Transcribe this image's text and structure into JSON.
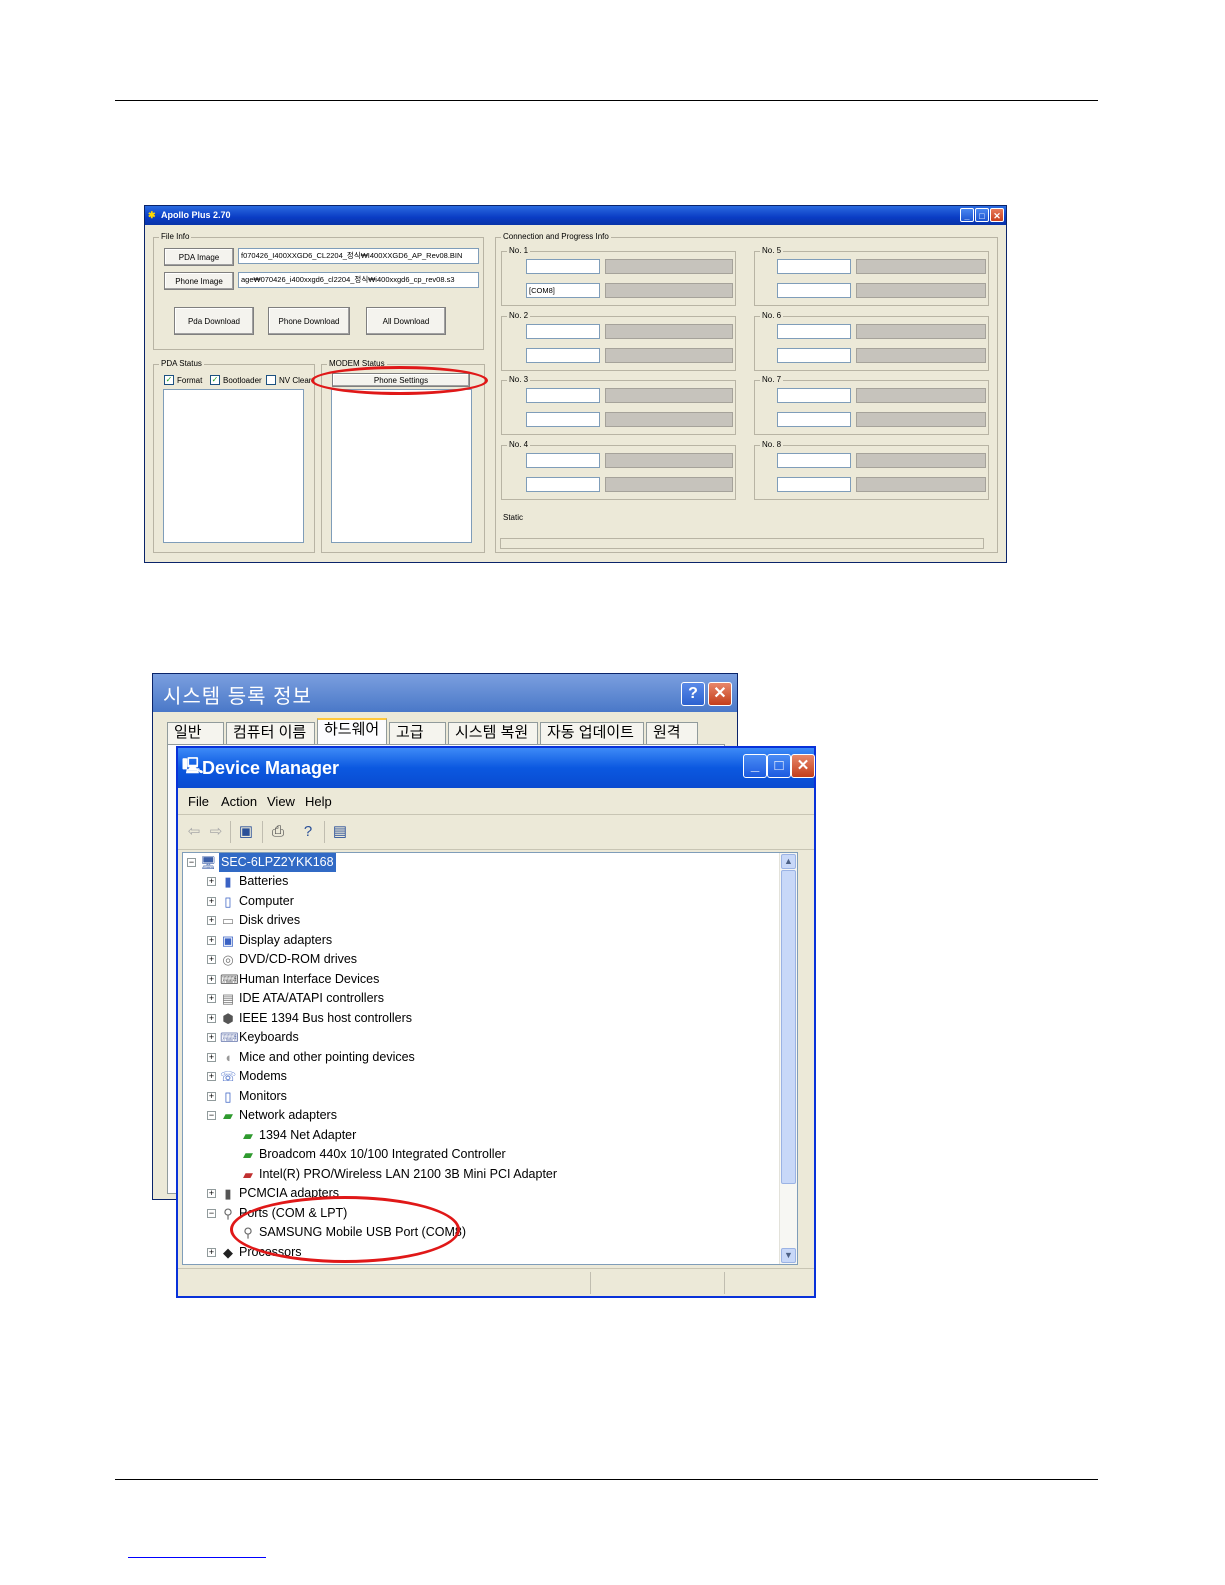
{
  "apollo": {
    "title": "Apollo Plus 2.70",
    "file_info": {
      "group_label": "File Info",
      "pda_image_button": "PDA Image",
      "pda_image_path": "f070426_I400XXGD6_CL2204_정식₩I400XXGD6_AP_Rev08.BIN",
      "phone_image_button": "Phone Image",
      "phone_image_path": "age₩070426_i400xxgd6_cl2204_정식₩i400xxgd6_cp_rev08.s3",
      "pda_download_button": "Pda Download",
      "phone_download_button": "Phone Download",
      "all_download_button": "All Download"
    },
    "pda_status": {
      "group_label": "PDA Status",
      "format_label": "Format",
      "bootloader_label": "Bootloader",
      "nv_clear_label": "NV Clear",
      "checkmark": "✓"
    },
    "modem_status": {
      "group_label": "MODEM Status",
      "phone_settings_button": "Phone Settings"
    },
    "connection": {
      "group_label": "Connection and Progress Info",
      "slots": [
        {
          "label": "No. 1",
          "port1": "",
          "port2": "[COM8]"
        },
        {
          "label": "No. 2",
          "port1": "",
          "port2": ""
        },
        {
          "label": "No. 3",
          "port1": "",
          "port2": ""
        },
        {
          "label": "No. 4",
          "port1": "",
          "port2": ""
        },
        {
          "label": "No. 5",
          "port1": "",
          "port2": ""
        },
        {
          "label": "No. 6",
          "port1": "",
          "port2": ""
        },
        {
          "label": "No. 7",
          "port1": "",
          "port2": ""
        },
        {
          "label": "No. 8",
          "port1": "",
          "port2": ""
        }
      ],
      "static_label": "Static"
    }
  },
  "system_dialog": {
    "title": "시스템 등록 정보",
    "help_button": "?",
    "close_button": "✕",
    "tabs": [
      "일반",
      "컴퓨터 이름",
      "하드웨어",
      "고급",
      "시스템 복원",
      "자동 업데이트",
      "원격"
    ],
    "active_tab": "하드웨어"
  },
  "device_manager": {
    "title": "Device Manager",
    "menu": [
      "File",
      "Action",
      "View",
      "Help"
    ],
    "toolbar_icons": [
      "back-icon",
      "forward-icon",
      "properties-icon",
      "print-icon",
      "help-icon",
      "monitor-icon"
    ],
    "root": "SEC-6LPZ2YKK168",
    "categories": [
      "Batteries",
      "Computer",
      "Disk drives",
      "Display adapters",
      "DVD/CD-ROM drives",
      "Human Interface Devices",
      "IDE ATA/ATAPI controllers",
      "IEEE 1394 Bus host controllers",
      "Keyboards",
      "Mice and other pointing devices",
      "Modems",
      "Monitors",
      "Network adapters"
    ],
    "network_children": [
      "1394 Net Adapter",
      "Broadcom 440x 10/100 Integrated Controller",
      "Intel(R) PRO/Wireless LAN 2100 3B Mini PCI Adapter"
    ],
    "pcmcia": "PCMCIA adapters",
    "ports": "Ports (COM & LPT)",
    "ports_child": "SAMSUNG Mobile USB Port (COM8)",
    "processors": "Processors"
  },
  "colors": {
    "highlight_ellipse": "#e01818",
    "xp_title_blue": "#0b58e0",
    "selection": "#316ac5"
  }
}
